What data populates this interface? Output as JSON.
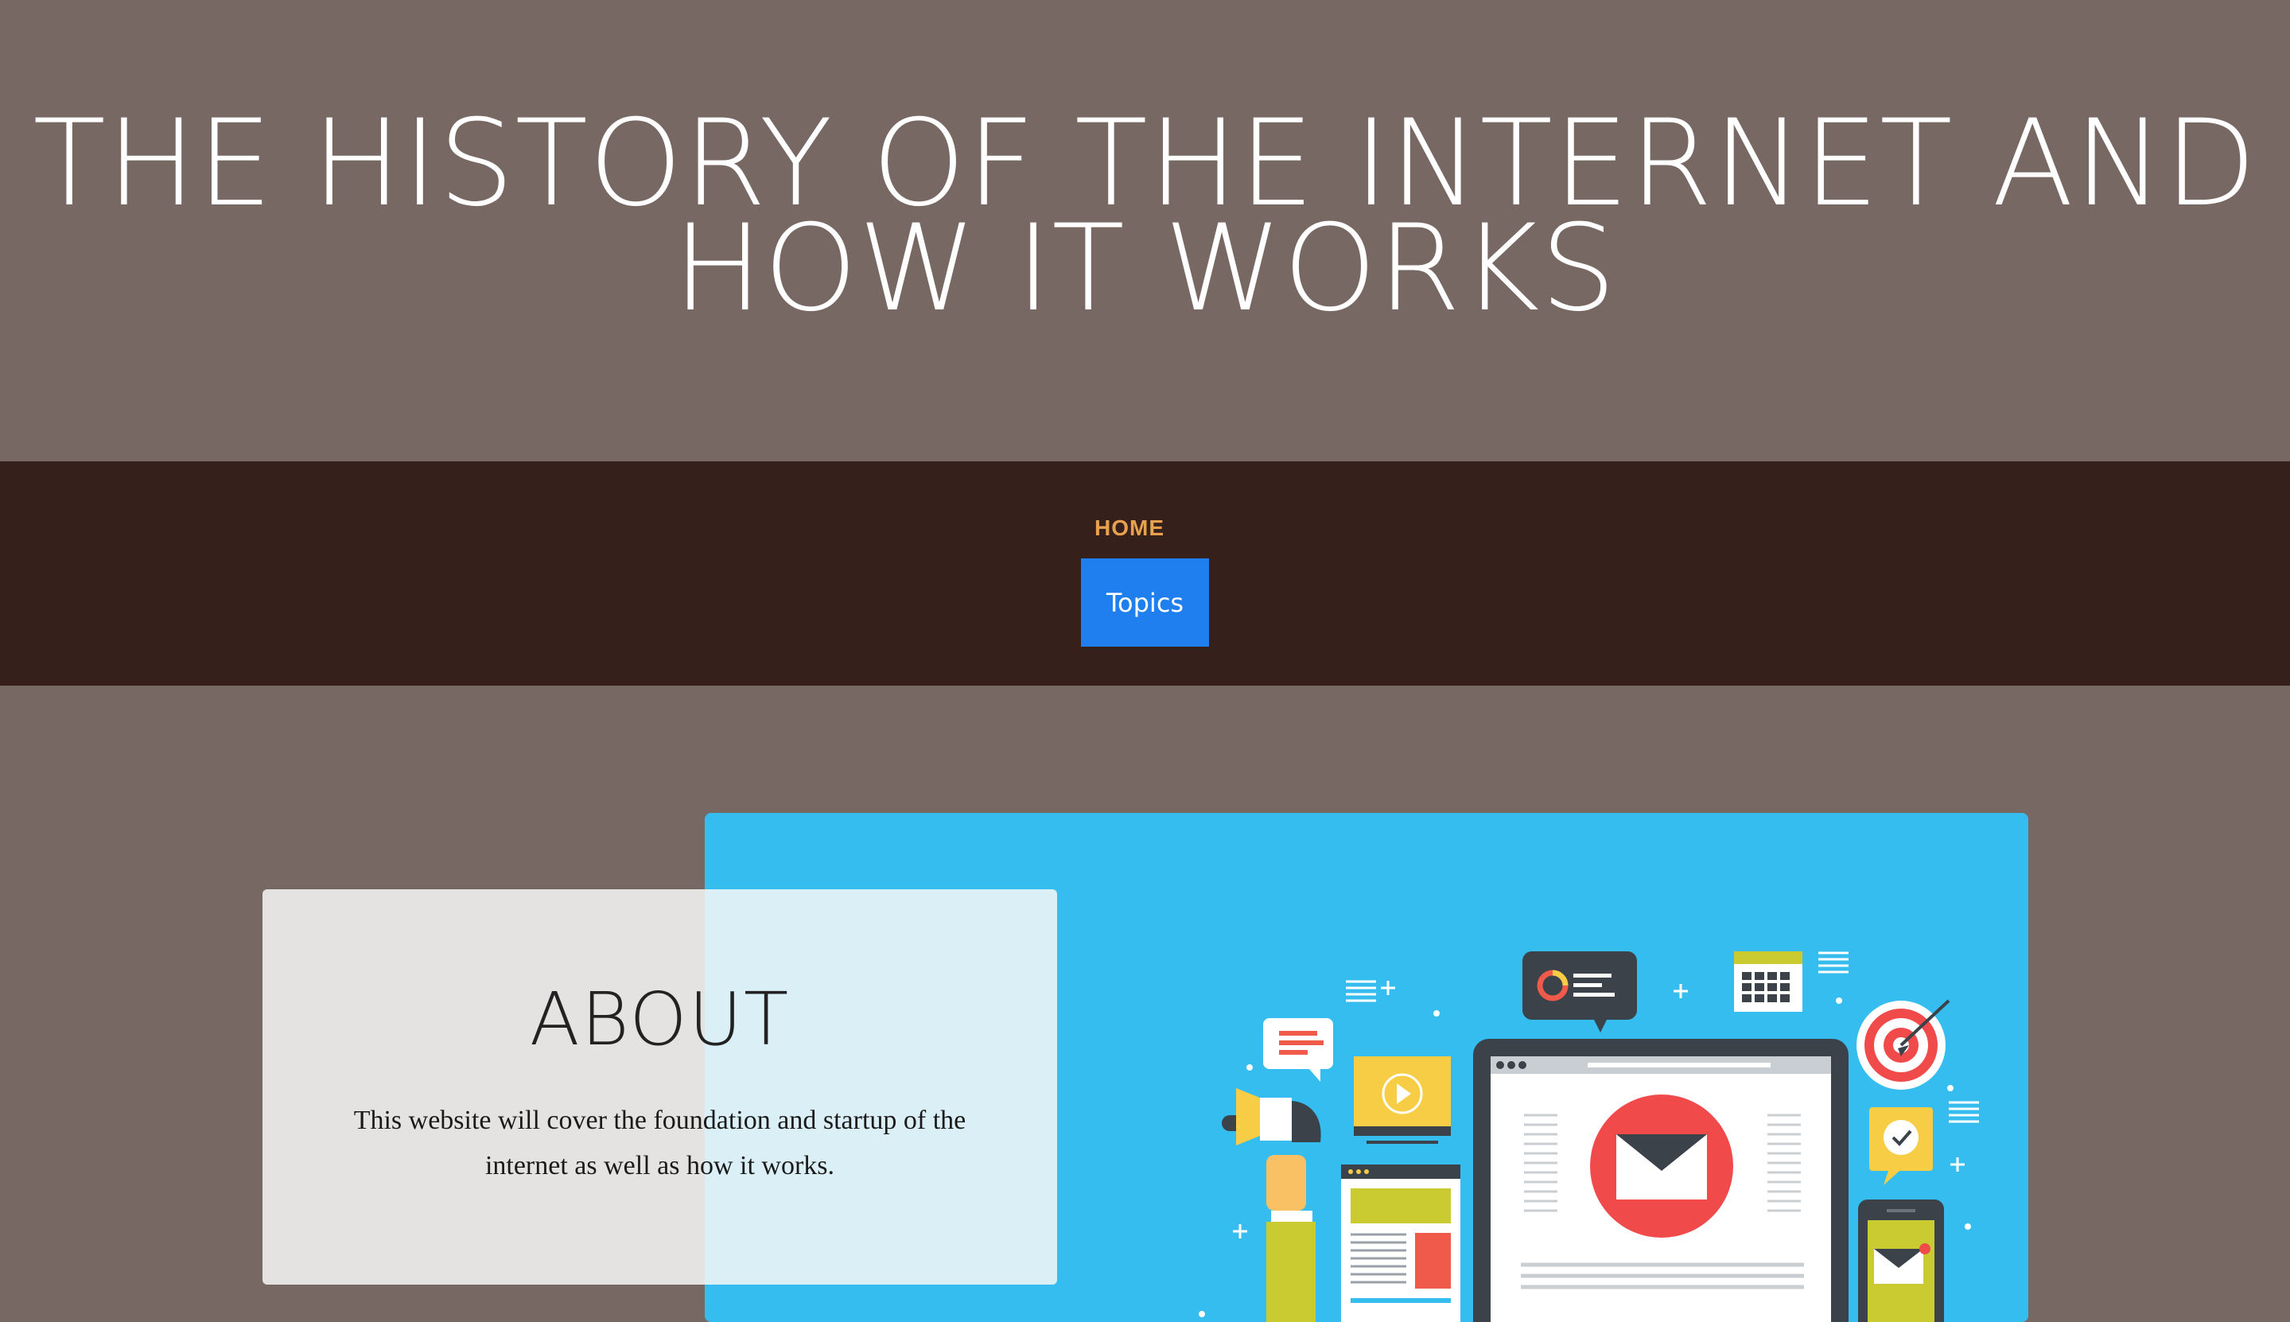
{
  "header": {
    "title": "THE HISTORY OF THE INTERNET AND HOW IT WORKS"
  },
  "nav": {
    "home_label": "HOME",
    "topics_label": "Topics"
  },
  "about": {
    "title": "ABOUT",
    "text": "This website will cover the foundation and startup of the internet as well as how it works."
  },
  "illustration": {
    "icons": [
      "megaphone-icon",
      "chat-bubble-icon",
      "video-player-icon",
      "document-icon",
      "laptop-icon",
      "envelope-icon",
      "analytics-bubble-icon",
      "calendar-icon",
      "target-icon",
      "clock-bubble-icon",
      "smartphone-icon"
    ]
  },
  "colors": {
    "header_bg": "#786864",
    "nav_bg": "#36201b",
    "home_accent": "#e8a24e",
    "topics_button": "#1f7fee",
    "hero_panel": "#35bdef",
    "email_red": "#f04a4a"
  }
}
